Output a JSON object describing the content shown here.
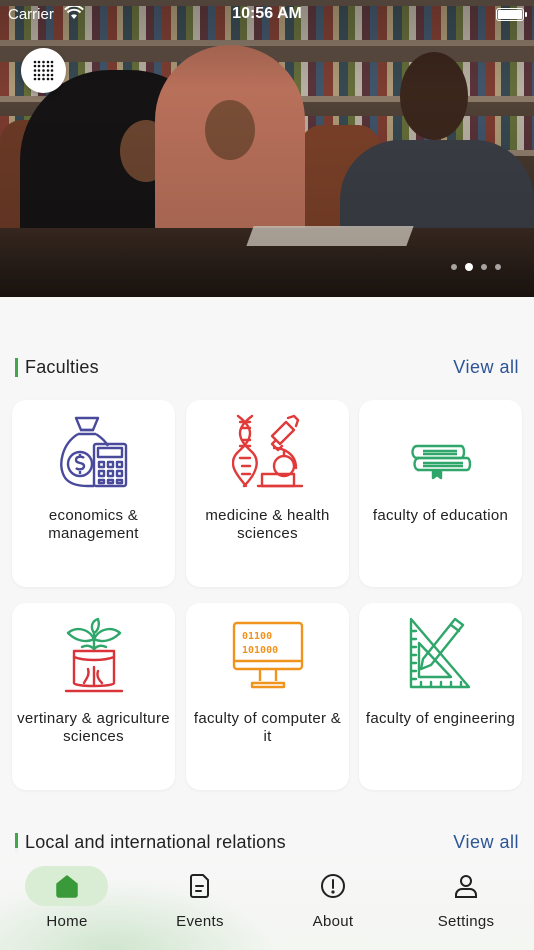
{
  "status_bar": {
    "carrier": "Carrier",
    "time": "10:56 AM"
  },
  "hero": {
    "slide_count": 4,
    "active_slide": 2
  },
  "faculties": {
    "title": "Faculties",
    "view_all": "View all",
    "items": [
      {
        "label": "economics & management",
        "icon": "money-bag-calculator-icon",
        "color": "#4a4a9c"
      },
      {
        "label": "medicine & health sciences",
        "icon": "dna-microscope-icon",
        "color": "#e03a3a"
      },
      {
        "label": "faculty of education",
        "icon": "books-stack-icon",
        "color": "#2fa66a"
      },
      {
        "label": "vertinary & agriculture sciences",
        "icon": "plant-pot-icon",
        "color": "#d9343a"
      },
      {
        "label": "faculty of computer & it",
        "icon": "computer-monitor-icon",
        "color": "#f0941e"
      },
      {
        "label": "faculty of engineering",
        "icon": "ruler-pencil-icon",
        "color": "#2fa66a"
      }
    ]
  },
  "relations": {
    "title": "Local and international relations",
    "view_all": "View all"
  },
  "bottom_nav": {
    "active": "Home",
    "items": [
      {
        "label": "Home",
        "icon": "home-icon"
      },
      {
        "label": "Events",
        "icon": "document-icon"
      },
      {
        "label": "About",
        "icon": "info-icon"
      },
      {
        "label": "Settings",
        "icon": "user-icon"
      }
    ]
  },
  "colors": {
    "accent": "#3fa64a",
    "link": "#2c5596",
    "active_pill": "#d9ecd4"
  }
}
